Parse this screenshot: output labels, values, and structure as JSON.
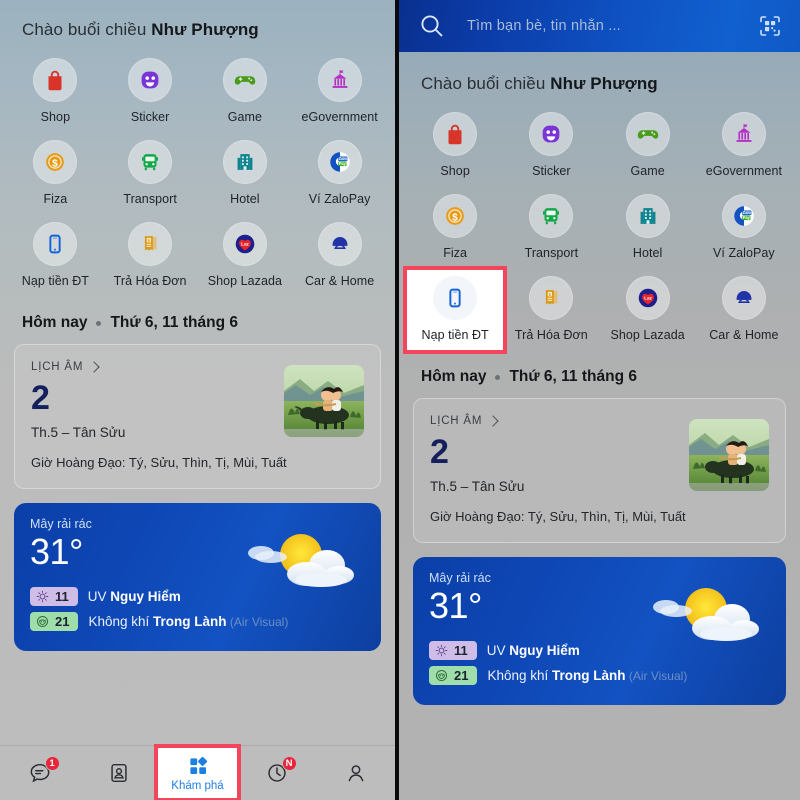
{
  "search": {
    "placeholder": "Tìm bạn bè, tin nhắn ...",
    "search_icon": "search-icon",
    "qr_icon": "qr-scan-icon"
  },
  "greeting": {
    "prefix": "Chào buổi chiều ",
    "name": "Như Phượng"
  },
  "shortcuts": [
    {
      "label": "Shop",
      "icon": "shopping-bag-icon",
      "color": "#d8342a"
    },
    {
      "label": "Sticker",
      "icon": "smiley-sticker-icon",
      "color": "#7a35d6"
    },
    {
      "label": "Game",
      "icon": "gamepad-icon",
      "color": "#4a9a1e"
    },
    {
      "label": "eGovernment",
      "icon": "government-icon",
      "color": "#b62fc4"
    },
    {
      "label": "Fiza",
      "icon": "dollar-coin-icon",
      "color": "#e79b14"
    },
    {
      "label": "Transport",
      "icon": "bus-icon",
      "color": "#14a84a"
    },
    {
      "label": "Hotel",
      "icon": "hotel-building-icon",
      "color": "#10838f"
    },
    {
      "label": "Ví ZaloPay",
      "icon": "zalopay-icon",
      "color": "#1151c2"
    },
    {
      "label": "Nạp tiền ĐT",
      "icon": "mobile-phone-icon",
      "color": "#1464d8"
    },
    {
      "label": "Trả Hóa Đơn",
      "icon": "invoice-icon",
      "color": "#d99a16"
    },
    {
      "label": "Shop Lazada",
      "icon": "lazada-heart-icon",
      "color": "#1d1f8c"
    },
    {
      "label": "Car & Home",
      "icon": "car-home-icon",
      "color": "#2233a8"
    }
  ],
  "highlight": {
    "shortcut_index": 8,
    "color": "#f5455c"
  },
  "today": {
    "label": "Hôm nay",
    "separator": "•",
    "date": "Thứ 6, 11 tháng 6"
  },
  "lunar_card": {
    "title": "LỊCH ÂM",
    "chevron": "chevron-right-icon",
    "day": "2",
    "month_zodiac": "Th.5 – Tân Sửu",
    "good_hours": "Giờ Hoàng Đạo: Tý, Sửu, Thìn, Tị, Mùi, Tuất",
    "image": "buffalo-boy-illustration"
  },
  "weather_card": {
    "condition": "Mây rải rác",
    "temperature": "31°",
    "art": "sun-behind-clouds-icon",
    "rows": [
      {
        "value": "11",
        "badge_icon": "uv-sun-icon",
        "prefix": "UV ",
        "status": "Nguy Hiểm",
        "source": ""
      },
      {
        "value": "21",
        "badge_icon": "air-mask-icon",
        "prefix": "Không khí ",
        "status": "Trong Lành",
        "source": " (Air Visual)"
      }
    ]
  },
  "bottom_nav": {
    "items": [
      {
        "label": "",
        "icon": "chat-bubble-icon",
        "badge": "1",
        "active": false
      },
      {
        "label": "",
        "icon": "contacts-icon",
        "badge": "",
        "active": false
      },
      {
        "label": "Khám phá",
        "icon": "discover-grid-icon",
        "badge": "",
        "active": true
      },
      {
        "label": "",
        "icon": "clock-timeline-icon",
        "badge": "N",
        "active": false
      },
      {
        "label": "",
        "icon": "person-icon",
        "badge": "",
        "active": false
      }
    ]
  },
  "colors": {
    "accent_blue": "#1f7fe0",
    "highlight_red": "#f5455c",
    "badge_red": "#e8253a",
    "header_blue": "#0f53c4"
  }
}
